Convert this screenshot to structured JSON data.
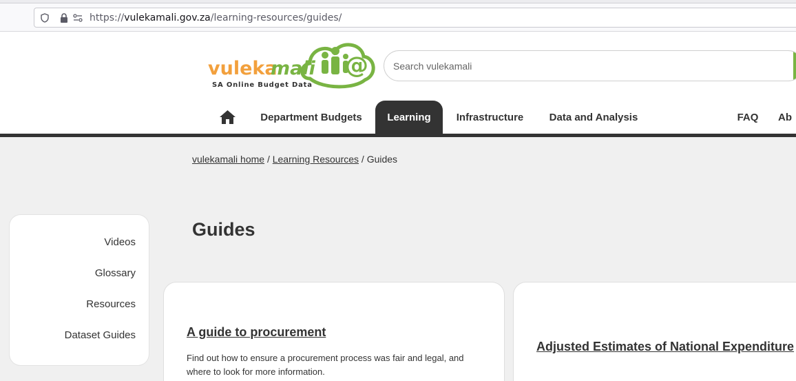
{
  "browser": {
    "url_scheme": "https://",
    "url_host": "vulekamali.gov.za",
    "url_path": "/learning-resources/guides/"
  },
  "header": {
    "logo": {
      "text_a": "vuleka",
      "text_b": "mali",
      "tagline": "SA Online Budget Data",
      "color_orange": "#f2a03d",
      "color_green": "#79b443"
    },
    "search": {
      "placeholder": "Search vulekamali"
    },
    "nav": {
      "home_icon": "home-icon",
      "items": [
        "Department Budgets",
        "Learning",
        "Infrastructure",
        "Data and Analysis",
        "FAQ",
        "Ab"
      ],
      "active": "Learning"
    }
  },
  "breadcrumb": {
    "home": "vulekamali home",
    "sep1": "/",
    "learning": "Learning Resources",
    "sep2": "/",
    "current": "Guides"
  },
  "sidebar": {
    "items": [
      "Videos",
      "Glossary",
      "Resources",
      "Dataset Guides"
    ]
  },
  "main": {
    "title": "Guides",
    "cards": [
      {
        "title": "A guide to procurement",
        "description": "Find out how to ensure a procurement process was fair and legal, and where to look for more information."
      },
      {
        "title": "Adjusted Estimates of National Expenditure",
        "description": ""
      }
    ]
  },
  "colors": {
    "nav_dark": "#333333",
    "accent_green": "#79b443",
    "page_bg": "#f0f0f0"
  }
}
